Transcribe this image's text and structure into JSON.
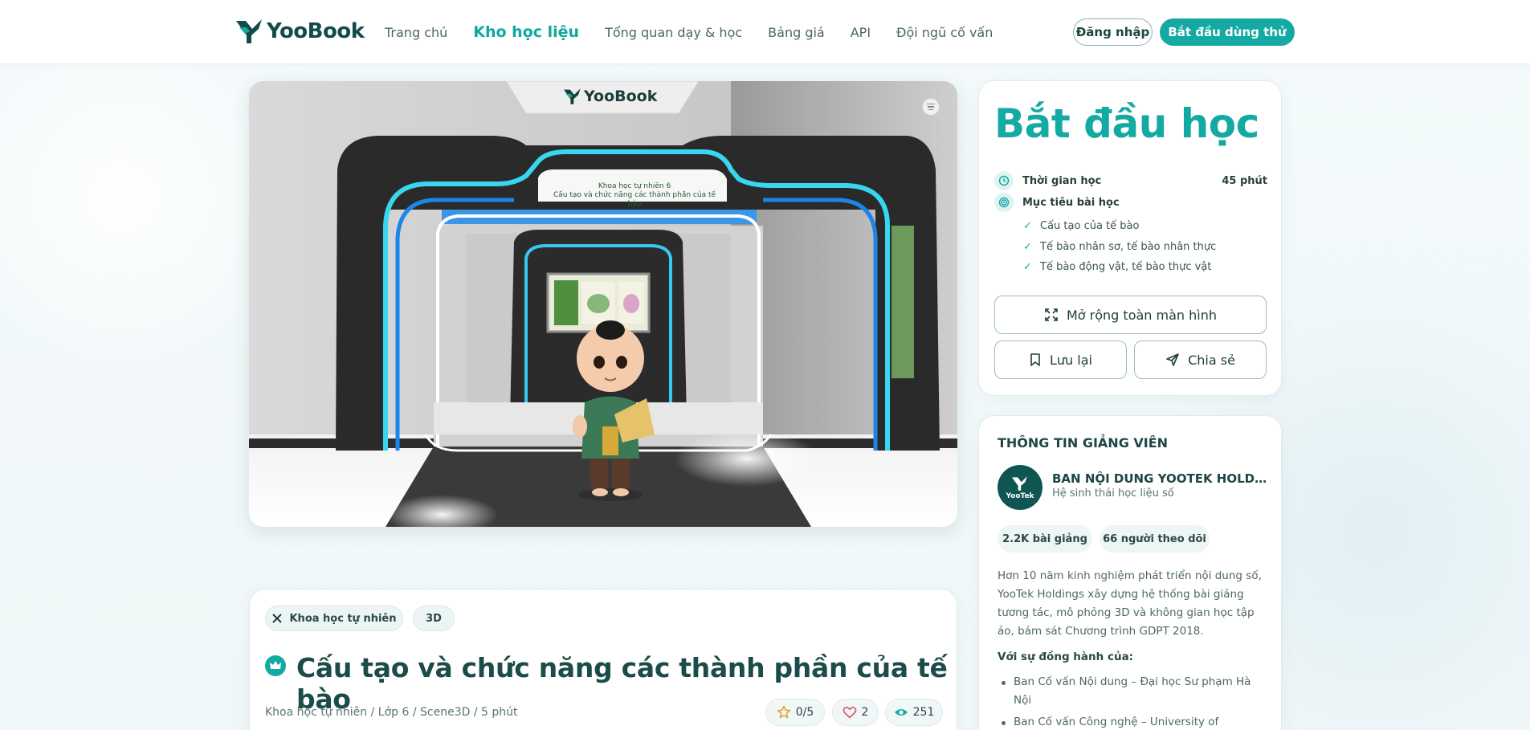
{
  "brand": {
    "name": "YooBook",
    "accent": "#14a9a2",
    "dark": "#124c4a"
  },
  "nav": {
    "items": [
      {
        "label": "Trang chủ"
      },
      {
        "label": "Kho học liệu",
        "active": true
      },
      {
        "label": "Tổng quan dạy & học"
      },
      {
        "label": "Bảng giá"
      },
      {
        "label": "API"
      },
      {
        "label": "Đội ngũ cố vấn"
      }
    ],
    "login_label": "Đăng nhập",
    "trial_label": "Bắt đầu dùng thử"
  },
  "viewer": {
    "logo": "YooBook",
    "sign_line1": "Khoa học tự nhiên 6",
    "sign_line2": "Cấu tạo và chức năng các thành phần của tế bào",
    "menu_icon": "menu-icon"
  },
  "start_card": {
    "title": "Bắt đầu học",
    "duration_label": "Thời gian học",
    "duration_value": "45 phút",
    "goal_label": "Mục tiêu bài học",
    "goals": [
      "Cấu tạo của tế bào",
      "Tế bào nhân sơ, tế bào nhân thực",
      "Tế bào động vật, tế bào thực vật"
    ],
    "fullscreen_label": "Mở rộng toàn màn hình",
    "save_label": "Lưu lại",
    "share_label": "Chia sẻ"
  },
  "teacher": {
    "heading": "THÔNG TIN GIẢNG VIÊN",
    "avatar_text": "YooTek",
    "name": "BAN NỘI DUNG YOOTEK HOLDINGS",
    "subtitle": "Hệ sinh thái học liệu số",
    "lectures": "2.2K bài giảng",
    "followers": "66 người theo dõi",
    "description": "Hơn 10 năm kinh nghiệm phát triển nội dung số, YooTek Holdings xây dựng hệ thống bài giảng tương tác, mô phỏng 3D và không gian học tập ảo, bám sát Chương trình GDPT 2018.",
    "with_label": "Với sự đồng hành của:",
    "partners": [
      "Ban Cố vấn Nội dung – Đại học Sư phạm Hà Nội",
      "Ban Cố vấn Công nghệ – University of"
    ]
  },
  "lesson": {
    "subject_tag": "Khoa học tự nhiên",
    "type_tag": "3D",
    "title": "Cấu tạo và chức năng các thành phần của tế bào",
    "path": "Khoa học tự nhiên / Lớp 6 / Scene3D / 5 phút",
    "rating": "0/5",
    "likes": "2",
    "views": "251"
  }
}
